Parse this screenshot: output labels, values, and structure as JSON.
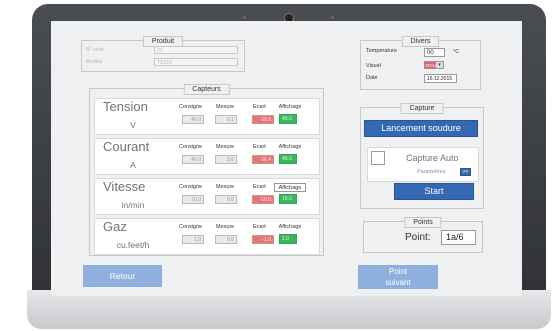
{
  "produit": {
    "title": "Produit",
    "fields": [
      {
        "label": "N° série",
        "value": "21"
      },
      {
        "label": "Modèle",
        "value": "TS210"
      }
    ]
  },
  "capteurs": {
    "title": "Capteurs",
    "headers": {
      "consigne": "Consigne",
      "mesure": "Mesure",
      "ecart": "Ecart",
      "affichage": "Affichage"
    },
    "rows": [
      {
        "name": "Tension",
        "unit": "V",
        "consigne": "40.0",
        "mesure": "0.1",
        "ecart": "-39.9",
        "affichage": "40.0"
      },
      {
        "name": "Courant",
        "unit": "A",
        "consigne": "40.0",
        "mesure": "3.6",
        "ecart": "-36.4",
        "affichage": "40.0"
      },
      {
        "name": "Vitesse",
        "unit": "in/min",
        "consigne": "10.0",
        "mesure": "0.0",
        "ecart": "-10.0",
        "affichage": "10.0"
      },
      {
        "name": "Gaz",
        "unit": "cu.feet/h",
        "consigne": "1.0",
        "mesure": "0.0",
        "ecart": "-1.0",
        "affichage": "1.0"
      }
    ]
  },
  "divers": {
    "title": "Divers",
    "temperature_label": "Temperature",
    "temperature_value": "00",
    "temperature_unit": "°C",
    "visuel_label": "Visuel",
    "visuel_value": "ROUGE",
    "visuel_color": "#e3626b",
    "date_label": "Date",
    "date_value": "16.12.2015"
  },
  "capture": {
    "title": "Capture",
    "lancement_label": "Lancement soudure",
    "auto_label": "Capture Auto",
    "parametres_label": "Paramètres",
    "parametres_btn": ">>",
    "start_label": "Start"
  },
  "points": {
    "title": "Points",
    "label": "Point:",
    "value": "1a/6"
  },
  "buttons": {
    "retour": "Retour",
    "point_suivant_line1": "Point",
    "point_suivant_line2": "suivant"
  },
  "colors": {
    "accent": "#3468b3",
    "light_button": "#8fb0df",
    "ok": "#3fb553",
    "error": "#e5757d"
  }
}
